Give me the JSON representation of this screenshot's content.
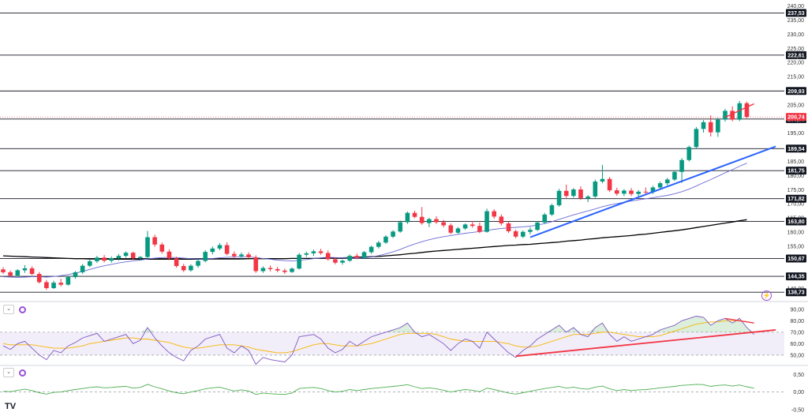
{
  "chart_data": {
    "type": "candlestick",
    "logo": "TV",
    "price_axis": {
      "range": [
        136,
        241
      ],
      "ticks": [
        "240,00",
        "235,00",
        "230,00",
        "225,00",
        "220,00",
        "215,00",
        "205,00",
        "195,00",
        "185,00",
        "180,00",
        "175,00",
        "170,00",
        "165,00",
        "160,00",
        "155,00",
        "145,00",
        "140,00"
      ],
      "ticks_values": [
        240,
        235,
        230,
        225,
        220,
        215,
        205,
        195,
        185,
        180,
        175,
        170,
        165,
        160,
        155,
        145,
        140
      ]
    },
    "levels": [
      {
        "label": "237,53",
        "value": 237.53
      },
      {
        "label": "222,61",
        "value": 222.61
      },
      {
        "label": "209,93",
        "value": 209.93
      },
      {
        "label": "200,00",
        "value": 200.0
      },
      {
        "label": "189,54",
        "value": 189.54
      },
      {
        "label": "181,75",
        "value": 181.75
      },
      {
        "label": "171,82",
        "value": 171.82
      },
      {
        "label": "163,80",
        "value": 163.8
      },
      {
        "label": "150,67",
        "value": 150.67
      },
      {
        "label": "144,35",
        "value": 144.35
      },
      {
        "label": "138,73",
        "value": 138.73
      }
    ],
    "last_price": {
      "label": "200,74",
      "value": 200.74
    },
    "colors": {
      "up": "#089981",
      "down": "#f23645",
      "level": "#131722",
      "trend": "#2962ff",
      "rsi": "#7e57c2",
      "rsi_ma": "#f7b500",
      "divergence": "#f23645",
      "momentum": "#4caf50"
    },
    "candles_ohlc": [
      [
        146.8,
        147.6,
        145.2,
        145.8
      ],
      [
        145.8,
        146.4,
        144.1,
        144.6
      ],
      [
        144.6,
        146.9,
        144.2,
        146.5
      ],
      [
        146.5,
        148.3,
        145.6,
        147.2
      ],
      [
        147.2,
        147.9,
        144.8,
        145.2
      ],
      [
        145.2,
        145.9,
        141.8,
        142.3
      ],
      [
        142.3,
        143.1,
        139.6,
        140.2
      ],
      [
        140.2,
        142.8,
        139.9,
        142.1
      ],
      [
        142.1,
        143.5,
        140.8,
        141.4
      ],
      [
        141.4,
        144.6,
        141.1,
        144.1
      ],
      [
        144.1,
        146.2,
        143.5,
        145.8
      ],
      [
        145.8,
        148.7,
        145.2,
        148.1
      ],
      [
        148.1,
        150.4,
        147.6,
        149.7
      ],
      [
        149.7,
        151.6,
        149.1,
        151.0
      ],
      [
        151.0,
        151.9,
        149.3,
        149.9
      ],
      [
        149.9,
        151.4,
        149.2,
        150.8
      ],
      [
        150.8,
        152.3,
        149.9,
        151.6
      ],
      [
        151.6,
        153.2,
        151.0,
        152.7
      ],
      [
        152.7,
        153.1,
        150.2,
        150.8
      ],
      [
        150.8,
        151.6,
        149.9,
        151.2
      ],
      [
        151.2,
        160.4,
        150.6,
        158.2
      ],
      [
        158.2,
        159.1,
        154.8,
        155.6
      ],
      [
        155.6,
        156.3,
        152.4,
        153.1
      ],
      [
        153.1,
        153.9,
        150.1,
        150.7
      ],
      [
        150.7,
        151.3,
        147.4,
        148.0
      ],
      [
        148.0,
        148.8,
        145.9,
        146.5
      ],
      [
        146.5,
        148.6,
        146.0,
        148.1
      ],
      [
        148.1,
        150.3,
        147.4,
        149.8
      ],
      [
        149.8,
        153.6,
        149.3,
        153.0
      ],
      [
        153.0,
        154.9,
        152.1,
        154.2
      ],
      [
        154.2,
        156.1,
        153.6,
        155.4
      ],
      [
        155.4,
        156.4,
        151.8,
        152.3
      ],
      [
        152.3,
        153.2,
        150.7,
        151.5
      ],
      [
        151.5,
        152.8,
        150.3,
        152.1
      ],
      [
        152.1,
        152.9,
        150.8,
        151.1
      ],
      [
        151.1,
        151.8,
        145.6,
        146.2
      ],
      [
        146.2,
        147.9,
        145.6,
        147.3
      ],
      [
        147.3,
        148.2,
        146.1,
        146.9
      ],
      [
        146.9,
        147.7,
        145.8,
        146.4
      ],
      [
        146.4,
        147.1,
        145.2,
        145.9
      ],
      [
        145.9,
        147.5,
        145.6,
        147.1
      ],
      [
        147.1,
        152.6,
        146.8,
        152.0
      ],
      [
        152.0,
        153.1,
        151.2,
        152.5
      ],
      [
        152.5,
        153.8,
        151.6,
        153.2
      ],
      [
        153.2,
        154.1,
        152.0,
        152.6
      ],
      [
        152.6,
        153.5,
        149.9,
        150.4
      ],
      [
        150.4,
        151.0,
        148.6,
        149.2
      ],
      [
        149.2,
        150.3,
        148.5,
        149.9
      ],
      [
        149.9,
        152.1,
        149.5,
        151.6
      ],
      [
        151.6,
        152.4,
        150.4,
        150.9
      ],
      [
        150.9,
        153.3,
        150.6,
        152.9
      ],
      [
        152.9,
        155.2,
        152.3,
        154.8
      ],
      [
        154.8,
        156.9,
        154.2,
        156.3
      ],
      [
        156.3,
        158.9,
        155.8,
        158.4
      ],
      [
        158.4,
        160.7,
        157.9,
        160.2
      ],
      [
        160.2,
        164.1,
        159.8,
        163.5
      ],
      [
        163.5,
        167.3,
        162.9,
        166.8
      ],
      [
        166.8,
        167.6,
        164.9,
        165.4
      ],
      [
        165.4,
        168.9,
        162.6,
        163.2
      ],
      [
        163.2,
        165.1,
        161.8,
        164.6
      ],
      [
        164.6,
        165.6,
        162.9,
        163.5
      ],
      [
        163.5,
        164.3,
        161.7,
        162.4
      ],
      [
        162.4,
        163.1,
        159.2,
        159.8
      ],
      [
        159.8,
        161.8,
        159.4,
        161.3
      ],
      [
        161.3,
        163.1,
        160.8,
        162.7
      ],
      [
        162.7,
        163.9,
        161.6,
        162.2
      ],
      [
        162.2,
        163.4,
        159.6,
        160.1
      ],
      [
        160.1,
        168.3,
        159.8,
        167.4
      ],
      [
        167.4,
        168.1,
        164.7,
        165.5
      ],
      [
        165.5,
        166.3,
        162.4,
        163.1
      ],
      [
        163.1,
        163.8,
        159.7,
        160.3
      ],
      [
        160.3,
        160.9,
        157.8,
        158.4
      ],
      [
        158.4,
        160.6,
        157.9,
        160.1
      ],
      [
        160.1,
        161.7,
        159.2,
        160.8
      ],
      [
        160.8,
        163.9,
        160.4,
        163.4
      ],
      [
        163.4,
        166.8,
        162.9,
        166.2
      ],
      [
        166.2,
        170.1,
        165.7,
        169.5
      ],
      [
        169.5,
        175.3,
        169.0,
        174.6
      ],
      [
        174.6,
        176.8,
        172.1,
        172.8
      ],
      [
        172.8,
        175.6,
        172.2,
        175.1
      ],
      [
        175.1,
        176.2,
        171.4,
        172.0
      ],
      [
        172.0,
        173.1,
        170.6,
        172.6
      ],
      [
        172.6,
        178.6,
        172.1,
        177.9
      ],
      [
        177.9,
        183.8,
        177.3,
        178.8
      ],
      [
        178.8,
        179.5,
        174.2,
        174.8
      ],
      [
        174.8,
        175.7,
        172.9,
        173.6
      ],
      [
        173.6,
        175.2,
        172.8,
        174.7
      ],
      [
        174.7,
        175.6,
        172.8,
        173.5
      ],
      [
        173.5,
        174.9,
        172.6,
        174.3
      ],
      [
        174.3,
        175.8,
        173.4,
        174.1
      ],
      [
        174.1,
        176.4,
        173.5,
        175.8
      ],
      [
        175.8,
        177.9,
        175.2,
        177.3
      ],
      [
        177.3,
        179.2,
        176.5,
        178.6
      ],
      [
        178.6,
        181.9,
        178.1,
        181.3
      ],
      [
        181.3,
        186.2,
        177.4,
        185.5
      ],
      [
        185.5,
        190.6,
        185.0,
        190.1
      ],
      [
        190.1,
        197.2,
        189.5,
        196.5
      ],
      [
        196.5,
        199.6,
        195.2,
        198.9
      ],
      [
        198.9,
        201.3,
        193.8,
        195.3
      ],
      [
        195.3,
        200.4,
        193.7,
        199.8
      ],
      [
        199.8,
        203.6,
        199.1,
        202.9
      ],
      [
        202.9,
        204.5,
        199.2,
        199.8
      ],
      [
        199.8,
        206.4,
        199.3,
        205.6
      ],
      [
        205.6,
        206.2,
        200.3,
        200.74
      ]
    ],
    "sma_blue": [
      144.2,
      144.1,
      144.0,
      144.1,
      144.2,
      144.2,
      144.1,
      144.3,
      144.6,
      145.0,
      145.5,
      146.1,
      146.8,
      147.5,
      148.1,
      148.6,
      149.1,
      149.5,
      149.8,
      150.1,
      150.5,
      150.8,
      151.0,
      151.1,
      151.0,
      150.8,
      150.6,
      150.5,
      150.5,
      150.7,
      150.9,
      151.1,
      151.2,
      151.3,
      151.3,
      151.0,
      150.7,
      150.4,
      150.1,
      149.9,
      149.8,
      150.0,
      150.3,
      150.6,
      150.9,
      151.1,
      151.0,
      150.9,
      150.8,
      150.8,
      150.9,
      151.2,
      151.7,
      152.3,
      153.0,
      153.9,
      154.9,
      155.8,
      156.6,
      157.3,
      157.9,
      158.4,
      158.8,
      159.2,
      159.6,
      159.9,
      160.2,
      160.6,
      161.0,
      161.3,
      161.5,
      161.7,
      161.9,
      162.1,
      162.5,
      163.0,
      163.7,
      164.5,
      165.3,
      166.1,
      166.8,
      167.5,
      168.2,
      169.0,
      169.6,
      170.1,
      170.6,
      171.0,
      171.4,
      171.8,
      172.2,
      172.6,
      173.0,
      173.6,
      174.3,
      175.2,
      176.3,
      177.5,
      178.6,
      179.8,
      181.0,
      182.1,
      183.3,
      184.4
    ],
    "sma_black": [
      151.6,
      151.5,
      151.4,
      151.3,
      151.2,
      151.1,
      151.0,
      150.9,
      150.8,
      150.7,
      150.6,
      150.6,
      150.5,
      150.5,
      150.5,
      150.4,
      150.4,
      150.4,
      150.4,
      150.4,
      150.4,
      150.4,
      150.4,
      150.4,
      150.4,
      150.4,
      150.4,
      150.4,
      150.5,
      150.5,
      150.5,
      150.5,
      150.5,
      150.5,
      150.6,
      150.6,
      150.6,
      150.6,
      150.6,
      150.6,
      150.7,
      150.7,
      150.7,
      150.7,
      150.8,
      150.8,
      150.9,
      150.9,
      151.0,
      151.1,
      151.2,
      151.3,
      151.4,
      151.6,
      151.8,
      152.0,
      152.3,
      152.5,
      152.8,
      153.1,
      153.3,
      153.5,
      153.7,
      153.9,
      154.1,
      154.3,
      154.5,
      154.7,
      154.9,
      155.1,
      155.3,
      155.4,
      155.6,
      155.7,
      155.9,
      156.1,
      156.3,
      156.5,
      156.8,
      157.0,
      157.2,
      157.5,
      157.7,
      158.0,
      158.2,
      158.4,
      158.6,
      158.8,
      159.1,
      159.3,
      159.6,
      159.9,
      160.2,
      160.5,
      160.8,
      161.2,
      161.6,
      162.0,
      162.4,
      162.8,
      163.2,
      163.6,
      164.0,
      164.4
    ],
    "blue_trendline": {
      "from": {
        "candle": 73,
        "price": 158.2
      },
      "to": {
        "candle": 107,
        "price": 190.3
      }
    },
    "top_divergence_line": {
      "from": {
        "candle": 100,
        "price": 200.6
      },
      "to": {
        "candle": 104,
        "price": 205.4
      }
    },
    "rsi": {
      "ticks": [
        "90,00",
        "80,00",
        "70,00",
        "60,00",
        "50,00"
      ],
      "ticks_values": [
        90,
        80,
        70,
        60,
        50
      ],
      "range": [
        43,
        94
      ],
      "band": [
        50,
        70
      ],
      "values": [
        58,
        55,
        60,
        62,
        56,
        50,
        46,
        54,
        52,
        58,
        61,
        65,
        67,
        69,
        62,
        64,
        66,
        68,
        60,
        63,
        74,
        65,
        58,
        52,
        48,
        45,
        54,
        58,
        64,
        66,
        68,
        56,
        52,
        58,
        54,
        42,
        48,
        46,
        45,
        44,
        50,
        66,
        67,
        68,
        64,
        56,
        52,
        55,
        62,
        58,
        62,
        66,
        68,
        70,
        72,
        74,
        78,
        70,
        66,
        68,
        64,
        60,
        54,
        60,
        64,
        62,
        56,
        70,
        64,
        58,
        52,
        48,
        54,
        58,
        64,
        68,
        72,
        76,
        70,
        74,
        68,
        66,
        74,
        78,
        68,
        62,
        66,
        62,
        64,
        66,
        68,
        72,
        74,
        76,
        80,
        82,
        84,
        83,
        76,
        80,
        82,
        78,
        82,
        74,
        68
      ],
      "values_ma": [
        60,
        59,
        59,
        59,
        59,
        58,
        57,
        56,
        56,
        56,
        57,
        58,
        60,
        61,
        62,
        63,
        64,
        65,
        65,
        64,
        64,
        63,
        62,
        61,
        59,
        57,
        56,
        56,
        57,
        58,
        59,
        59,
        59,
        58,
        57,
        55,
        54,
        53,
        52,
        52,
        53,
        55,
        57,
        59,
        60,
        60,
        59,
        58,
        58,
        58,
        59,
        60,
        62,
        64,
        66,
        68,
        69,
        69,
        69,
        69,
        68,
        66,
        64,
        63,
        62,
        62,
        62,
        62,
        62,
        61,
        60,
        58,
        57,
        57,
        58,
        60,
        62,
        64,
        66,
        68,
        68,
        68,
        69,
        70,
        70,
        69,
        68,
        67,
        66,
        66,
        66,
        67,
        69,
        71,
        73,
        75,
        77,
        78,
        79,
        79,
        80,
        80,
        80,
        79,
        78
      ],
      "support_line": {
        "from": {
          "candle": 71,
          "value": 49
        },
        "to": {
          "candle": 107,
          "value": 72
        }
      },
      "divergence_line": {
        "from": {
          "candle": 100,
          "value": 82
        },
        "to": {
          "candle": 104,
          "value": 78
        }
      }
    },
    "momentum": {
      "ticks": [
        "0,50",
        "0,00",
        "-0,50"
      ],
      "ticks_values": [
        0.5,
        0.0,
        -0.5
      ],
      "range": [
        -0.55,
        0.6
      ],
      "values": [
        0.02,
        0.01,
        0.05,
        0.08,
        0.04,
        -0.02,
        -0.06,
        -0.01,
        0.0,
        0.04,
        0.07,
        0.1,
        0.13,
        0.15,
        0.12,
        0.13,
        0.15,
        0.16,
        0.11,
        0.13,
        0.22,
        0.15,
        0.09,
        0.03,
        -0.02,
        -0.05,
        0.0,
        0.04,
        0.09,
        0.12,
        0.14,
        0.08,
        0.03,
        0.06,
        0.03,
        -0.07,
        -0.03,
        -0.05,
        -0.06,
        -0.07,
        -0.03,
        0.1,
        0.12,
        0.13,
        0.1,
        0.04,
        0.0,
        0.02,
        0.07,
        0.04,
        0.07,
        0.1,
        0.12,
        0.14,
        0.16,
        0.18,
        0.21,
        0.15,
        0.1,
        0.12,
        0.09,
        0.05,
        0.0,
        0.04,
        0.07,
        0.05,
        0.01,
        0.11,
        0.07,
        0.02,
        -0.03,
        -0.06,
        -0.02,
        0.02,
        0.06,
        0.1,
        0.13,
        0.16,
        0.11,
        0.14,
        0.1,
        0.08,
        0.14,
        0.17,
        0.09,
        0.04,
        0.07,
        0.04,
        0.06,
        0.07,
        0.09,
        0.12,
        0.14,
        0.16,
        0.19,
        0.2,
        0.22,
        0.21,
        0.16,
        0.19,
        0.2,
        0.17,
        0.2,
        0.15,
        0.11
      ]
    }
  }
}
